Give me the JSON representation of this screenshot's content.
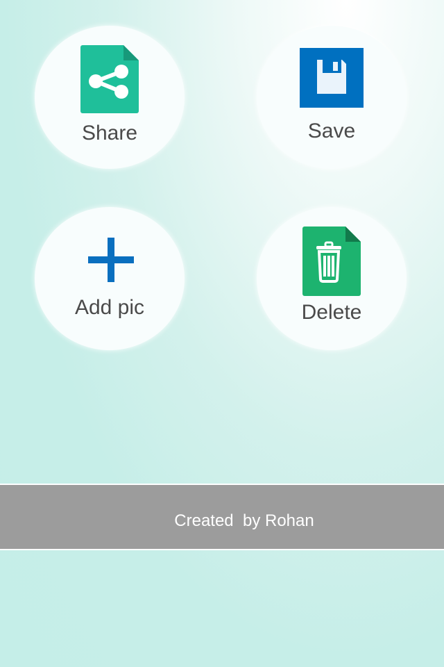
{
  "actions": {
    "share": {
      "label": "Share",
      "icon": "share-file-icon",
      "color": "#1fbf9a"
    },
    "save": {
      "label": "Save",
      "icon": "floppy-disk-icon",
      "color": "#0070c0"
    },
    "add_pic": {
      "label": "Add pic",
      "icon": "plus-icon",
      "color": "#0a6fbf"
    },
    "delete": {
      "label": "Delete",
      "icon": "trash-can-icon",
      "color": "#1db36f"
    }
  },
  "footer": {
    "credit": "Created  by Rohan"
  }
}
